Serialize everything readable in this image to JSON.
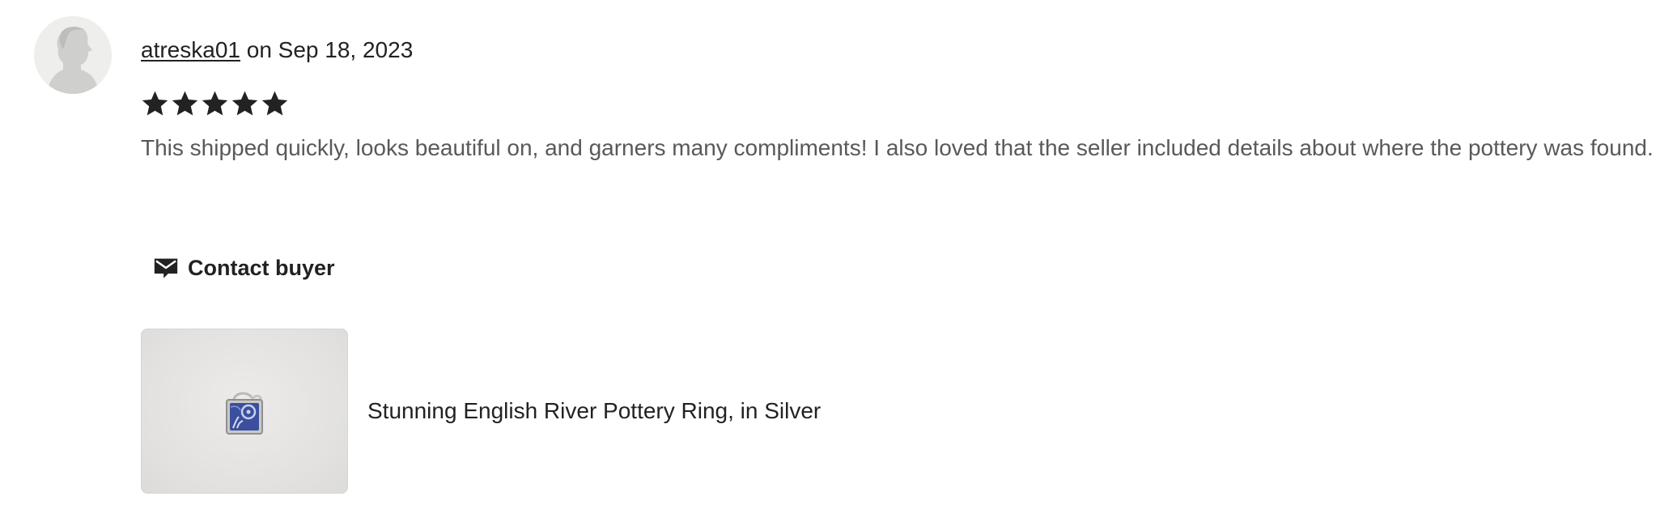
{
  "review": {
    "author": "atreska01",
    "date_text": " on Sep 18, 2023",
    "rating": 5,
    "rating_max": 5,
    "text": "This shipped quickly, looks beautiful on, and garners many compliments! I also loved that the seller included details about where the pottery was found.",
    "contact_label": "Contact buyer",
    "listing_title": "Stunning English River Pottery Ring, in Silver"
  },
  "colors": {
    "star": "#222222",
    "review_text": "#595959",
    "avatar_bg": "#eeeeec"
  },
  "icons": {
    "avatar": "default-user-avatar-icon",
    "star": "star-icon",
    "contact": "envelope-message-icon"
  }
}
